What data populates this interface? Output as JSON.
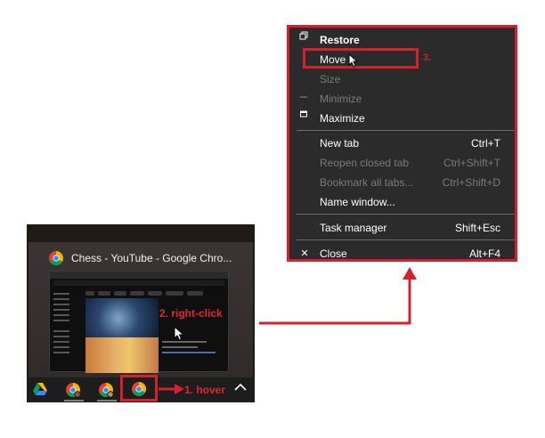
{
  "menu": {
    "items": [
      {
        "icon": "restore-icon",
        "label": "Restore",
        "shortcut": "",
        "disabled": false,
        "bold": true
      },
      {
        "icon": "",
        "label": "Move",
        "shortcut": "",
        "disabled": false,
        "bold": false
      },
      {
        "icon": "",
        "label": "Size",
        "shortcut": "",
        "disabled": true,
        "bold": false
      },
      {
        "icon": "minimize-icon",
        "label": "Minimize",
        "shortcut": "",
        "disabled": true,
        "bold": false
      },
      {
        "icon": "maximize-icon",
        "label": "Maximize",
        "shortcut": "",
        "disabled": false,
        "bold": false
      },
      {
        "icon": "",
        "label": "New tab",
        "shortcut": "Ctrl+T",
        "disabled": false,
        "bold": false
      },
      {
        "icon": "",
        "label": "Reopen closed tab",
        "shortcut": "Ctrl+Shift+T",
        "disabled": true,
        "bold": false
      },
      {
        "icon": "",
        "label": "Bookmark all tabs...",
        "shortcut": "Ctrl+Shift+D",
        "disabled": true,
        "bold": false
      },
      {
        "icon": "",
        "label": "Name window...",
        "shortcut": "",
        "disabled": false,
        "bold": false
      },
      {
        "icon": "",
        "label": "Task manager",
        "shortcut": "Shift+Esc",
        "disabled": false,
        "bold": false
      },
      {
        "icon": "close-icon",
        "label": "Close",
        "shortcut": "Alt+F4",
        "disabled": false,
        "bold": false
      }
    ]
  },
  "annotations": {
    "step1": "1. hover",
    "step2": "2. right-click",
    "step3": "3."
  },
  "preview": {
    "title": "Chess - YouTube - Google Chro..."
  },
  "colors": {
    "annotation_red": "#d6202c",
    "menu_bg": "#2b2b2b",
    "taskbar_bg": "#1d1d1d"
  },
  "taskbar": {
    "icons": [
      "google-drive-icon",
      "chrome-profile-icon",
      "chrome-profile-icon",
      "chrome-icon",
      "chevron-up-icon"
    ]
  }
}
